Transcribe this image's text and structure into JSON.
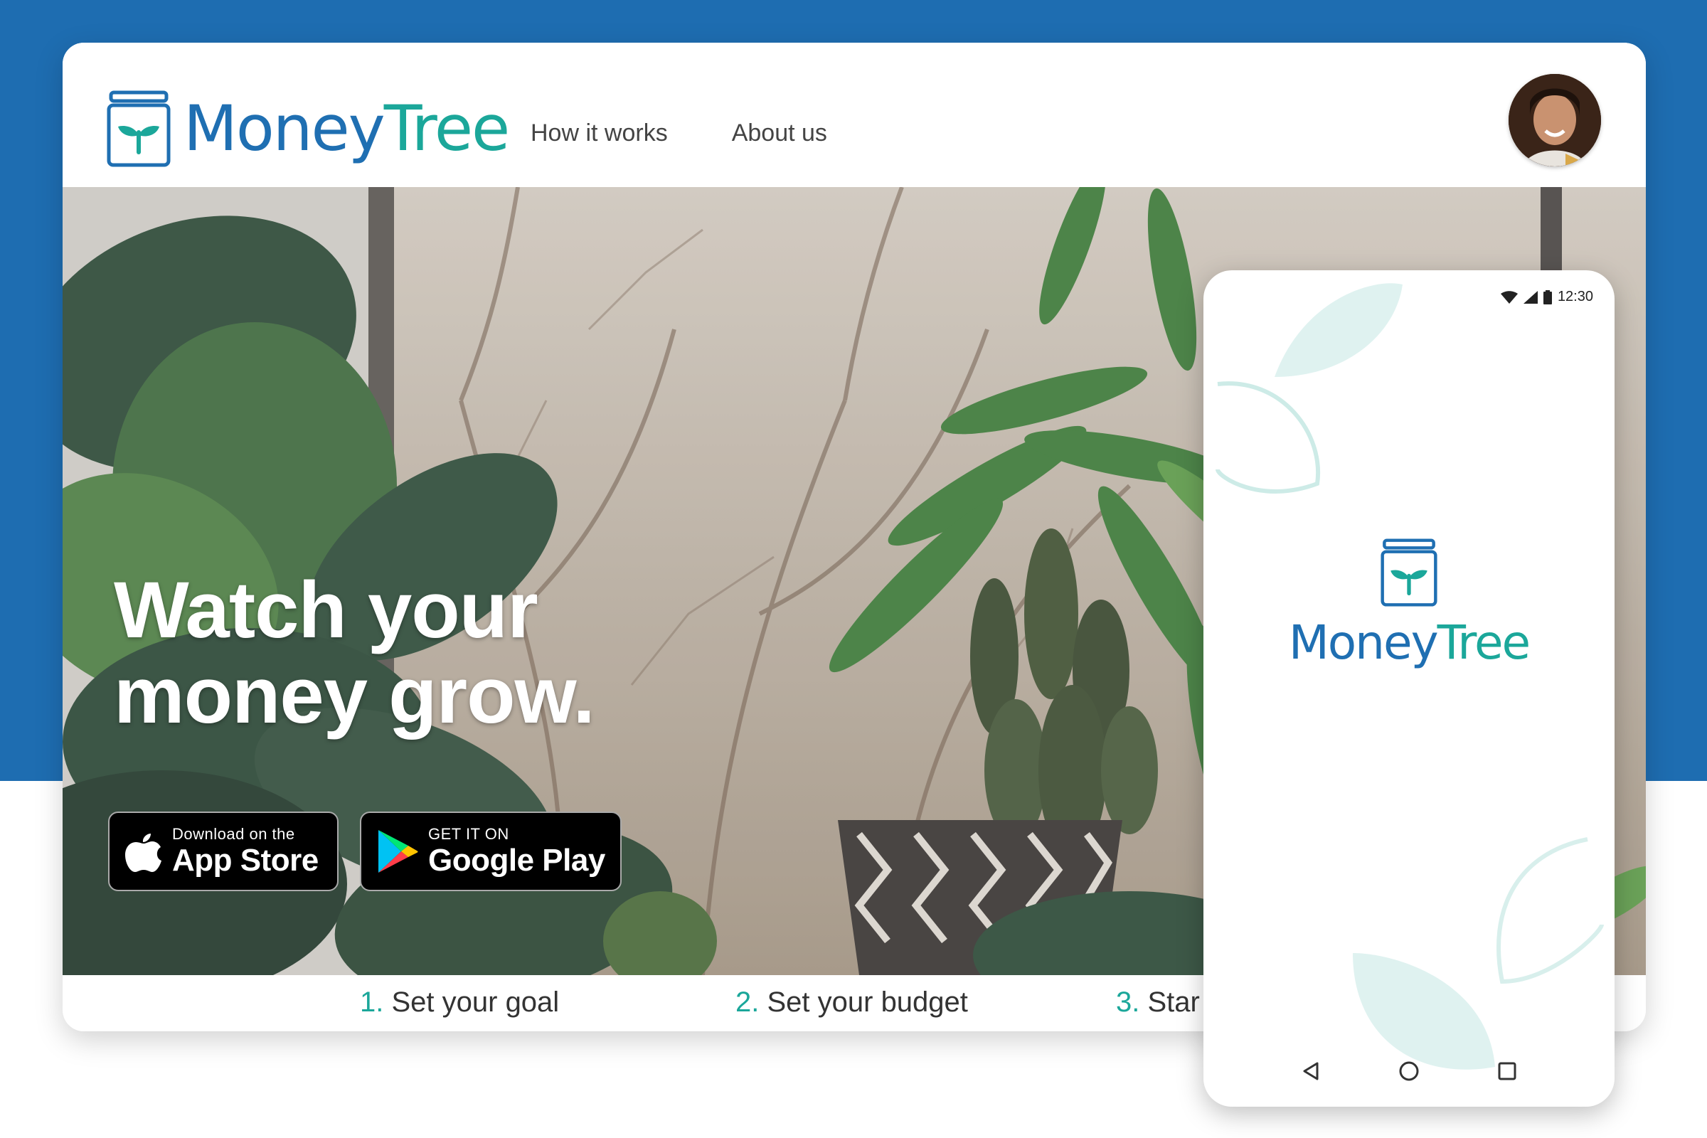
{
  "brand": {
    "name_part1": "Money",
    "name_part2": "Tree"
  },
  "nav": {
    "items": [
      {
        "label": "How it works"
      },
      {
        "label": "About us"
      }
    ]
  },
  "hero": {
    "title_line1": "Watch your",
    "title_line2": "money grow."
  },
  "stores": {
    "apple": {
      "small": "Download on the",
      "big": "App Store"
    },
    "google": {
      "small": "GET IT ON",
      "big": "Google Play"
    }
  },
  "steps": [
    {
      "num": "1.",
      "label": "Set your goal"
    },
    {
      "num": "2.",
      "label": "Set your budget"
    },
    {
      "num": "3.",
      "label": "Star"
    }
  ],
  "phone": {
    "status_time": "12:30",
    "logo_part1": "Money",
    "logo_part2": "Tree"
  },
  "colors": {
    "band_blue": "#1e6db1",
    "brand_blue": "#1f6fb2",
    "brand_teal": "#1ba79a",
    "leaf_tint": "#dff2f0"
  },
  "icons": [
    "jar-logo-icon",
    "apple-icon",
    "google-play-icon",
    "wifi-icon",
    "signal-icon",
    "battery-icon",
    "back-icon",
    "home-icon",
    "recents-icon"
  ]
}
